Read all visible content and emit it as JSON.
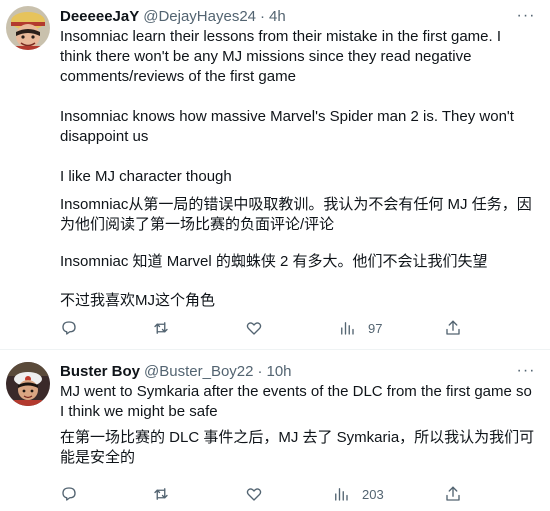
{
  "tweets": [
    {
      "display_name": "DeeeeeJaY",
      "handle": "@DejayHayes24",
      "separator": "·",
      "time": "4h",
      "more": "···",
      "paragraphs": [
        "Insomniac learn their lessons from their mistake in the first game. I think there won't be any MJ missions since they read negative comments/reviews of the first game",
        "Insomniac knows how massive Marvel's Spider man 2 is. They won't disappoint us",
        "I like MJ character though",
        "Insomniac从第一局的错误中吸取教训。我认为不会有任何 MJ 任务，因为他们阅读了第一场比赛的负面评论/评论",
        "Insomniac 知道 Marvel 的蜘蛛侠 2 有多大。他们不会让我们失望",
        "不过我喜欢MJ这个角色"
      ],
      "views": "97",
      "icons": [
        "reply-icon",
        "retweet-icon",
        "like-icon",
        "views-icon",
        "share-icon"
      ]
    },
    {
      "display_name": "Buster Boy",
      "handle": "@Buster_Boy22",
      "separator": "·",
      "time": "10h",
      "more": "···",
      "paragraphs": [
        "MJ went to Symkaria after the events of the DLC from the first game so I think we might be safe",
        "在第一场比赛的 DLC 事件之后，MJ 去了 Symkaria，所以我认为我们可能是安全的"
      ],
      "views": "203",
      "icons": [
        "reply-icon",
        "retweet-icon",
        "like-icon",
        "views-icon",
        "share-icon"
      ]
    }
  ]
}
